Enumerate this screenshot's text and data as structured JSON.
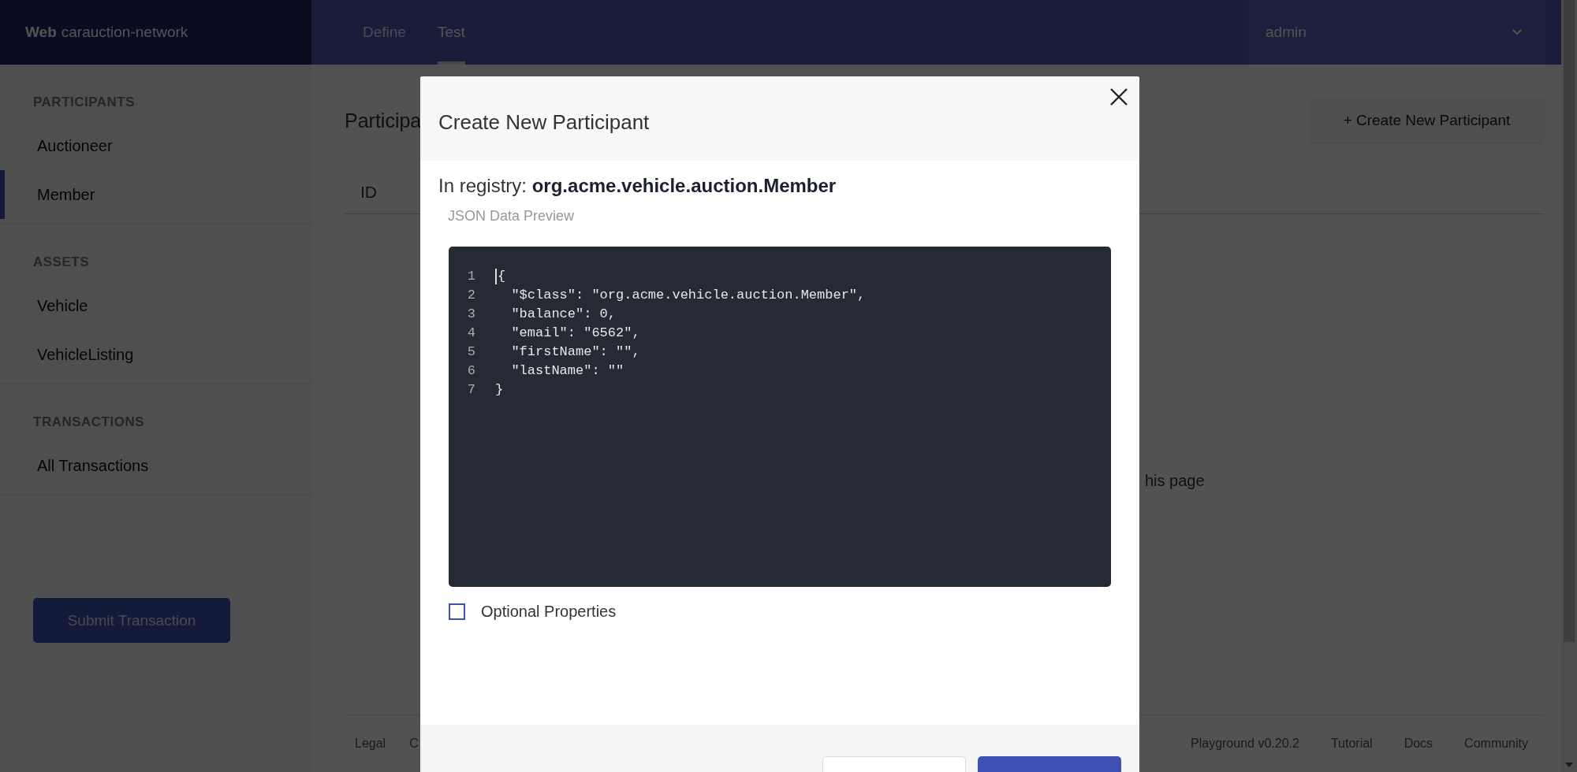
{
  "header": {
    "brand_bold": "Web",
    "brand": "carauction-network",
    "tabs": [
      {
        "label": "Define",
        "selected": false
      },
      {
        "label": "Test",
        "selected": true
      }
    ],
    "user": "admin"
  },
  "sidebar": {
    "sections": [
      {
        "heading": "PARTICIPANTS",
        "items": [
          {
            "label": "Auctioneer",
            "selected": false
          },
          {
            "label": "Member",
            "selected": true
          }
        ]
      },
      {
        "heading": "ASSETS",
        "items": [
          {
            "label": "Vehicle",
            "selected": false
          },
          {
            "label": "VehicleListing",
            "selected": false
          }
        ]
      },
      {
        "heading": "TRANSACTIONS",
        "items": [
          {
            "label": "All Transactions",
            "selected": false
          }
        ]
      }
    ],
    "submit_button": "Submit Transaction"
  },
  "main": {
    "title": "Participa",
    "create_button": "+ Create New Participant",
    "table": {
      "columns": [
        "ID"
      ]
    },
    "empty_message": "his page"
  },
  "footer": {
    "links_left": [
      "Legal",
      "C"
    ],
    "links_right": [
      "Playground v0.20.2",
      "Tutorial",
      "Docs",
      "Community"
    ]
  },
  "modal": {
    "title": "Create New Participant",
    "registry_label": "In registry: **org.acme.vehicle.auction.Member**",
    "preview_label": "JSON Data Preview",
    "code_lines": [
      {
        "number": "1",
        "text": "{"
      },
      {
        "number": "2",
        "text": "  \"$class\": \"org.acme.vehicle.auction.Member\","
      },
      {
        "number": "3",
        "text": "  \"balance\": 0,"
      },
      {
        "number": "4",
        "text": "  \"email\": \"6562\","
      },
      {
        "number": "5",
        "text": "  \"firstName\": \"\","
      },
      {
        "number": "6",
        "text": "  \"lastName\": \"\""
      },
      {
        "number": "7",
        "text": "}"
      }
    ],
    "optional_properties": {
      "label": "Optional Properties",
      "checked": false
    },
    "buttons": [
      {
        "kind": "secondary"
      },
      {
        "kind": "primary"
      }
    ]
  }
}
